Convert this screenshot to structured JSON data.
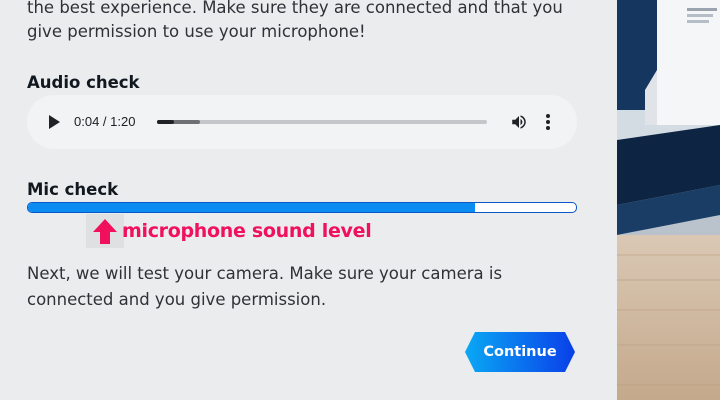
{
  "intro": {
    "line1": "the best experience. Make sure they are connected and that you",
    "line2": "give permission to use your microphone!"
  },
  "audio_check": {
    "title": "Audio check",
    "player": {
      "time": "0:04 / 1:20",
      "progress_fraction": 0.05,
      "buffered_fraction": 0.13
    }
  },
  "mic_check": {
    "title": "Mic check",
    "level_fraction": 0.815,
    "annotation": "microphone sound level"
  },
  "camera": {
    "line1": "Next, we will test your camera. Make sure your camera is",
    "line2": "connected and you give permission."
  },
  "continue_button": {
    "label": "Continue"
  },
  "colors": {
    "accent": "#0a8cf0",
    "annotation": "#f0105c",
    "button_gradient_start": "#0aa8f5",
    "button_gradient_end": "#0a3fe8"
  },
  "icons": [
    "play-icon",
    "volume-icon",
    "more-vert-icon",
    "arrow-up-icon"
  ]
}
